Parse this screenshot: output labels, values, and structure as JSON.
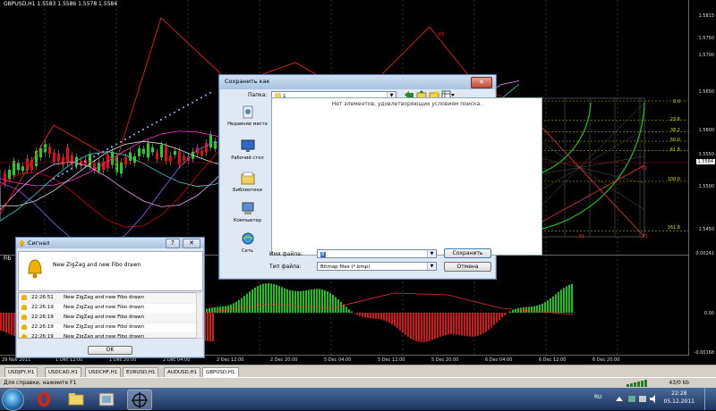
{
  "chart": {
    "title": "GBPUSD,H1  1.5583 1.5586 1.5578 1.5584",
    "indicator_label": "Fib",
    "price_labels": [
      "1.5815",
      "1.5750",
      "1.5700",
      "1.5650",
      "1.5600",
      "1.5550",
      "1.5500",
      "1.5450"
    ],
    "last_price": "1.5584",
    "indicator_scale": [
      "0.00242",
      "0.00",
      "-0.00168"
    ],
    "fibo_levels": [
      "0.0",
      "23.6",
      "38.2",
      "50.0",
      "61.8",
      "100.0",
      "161.8"
    ],
    "fibo_marks": [
      "P3",
      "P2",
      "P1",
      "P1"
    ],
    "time_labels": [
      "29 Nov 2011",
      "1 Dec 12:00",
      "1 Dec 20:00",
      "2 Dec 04:00",
      "2 Dec 12:00",
      "2 Dec 20:00",
      "5 Dec 04:00",
      "5 Dec 12:00",
      "5 Dec 20:00",
      "6 Dec 04:00",
      "6 Dec 12:00",
      "6 Dec 20:00"
    ]
  },
  "symbol_tabs": [
    {
      "label": "USDJPY,H1",
      "active": false
    },
    {
      "label": "USDCAD,H1",
      "active": false
    },
    {
      "label": "USDCHF,H1",
      "active": false
    },
    {
      "label": "EURUSD,H1",
      "active": false
    },
    {
      "label": "AUDUSD,H1",
      "active": false
    },
    {
      "label": "GBPUSD,H1",
      "active": true
    }
  ],
  "status": {
    "help": "Для справки, нажмите F1",
    "traffic": "43/0 kb"
  },
  "taskbar": {
    "lang": "RU",
    "time": "22:28",
    "date": "05.12.2011"
  },
  "save_dialog": {
    "title": "Сохранить как",
    "folder_label": "Папка:",
    "folder_value": "1",
    "empty_message": "Нет элементов, удовлетворяющих условиям поиска.",
    "places": [
      {
        "label": "Недавние места",
        "icon": "recent-places-icon"
      },
      {
        "label": "Рабочий стол",
        "icon": "desktop-icon"
      },
      {
        "label": "Библиотеки",
        "icon": "libraries-icon"
      },
      {
        "label": "Компьютер",
        "icon": "computer-icon"
      },
      {
        "label": "Сеть",
        "icon": "network-icon"
      }
    ],
    "filename_label": "Имя файла:",
    "filename_value": "8",
    "filetype_label": "Тип файла:",
    "filetype_value": "Bitmap files (*.bmp)",
    "save_button": "Сохранить",
    "cancel_button": "Отмена"
  },
  "alert_window": {
    "title": "Сигнал",
    "message": "New ZigZag and new Fibo drawn",
    "rows": [
      {
        "time": "22:26:51",
        "text": "New ZigZag and new Fibo drawn"
      },
      {
        "time": "22:26:19",
        "text": "New ZigZag and new Fibo drawn"
      },
      {
        "time": "22:26:19",
        "text": "New ZigZag and new Fibo drawn"
      },
      {
        "time": "22:26:19",
        "text": "New ZigZag and new Fibo drawn"
      },
      {
        "time": "22:26:19",
        "text": "New ZigZag and new Fibo drawn"
      }
    ],
    "ok_button": "OK"
  }
}
